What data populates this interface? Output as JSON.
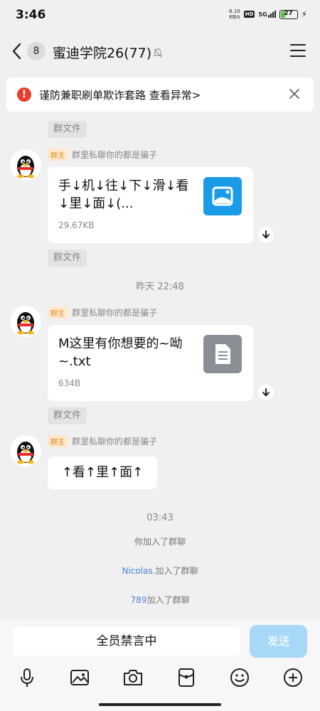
{
  "status_bar": {
    "time": "3:46",
    "net_speed_value": "6.10",
    "net_speed_unit": "KB/s",
    "hd": "HD",
    "network": "5G",
    "battery": "27",
    "battery_level": 0.27
  },
  "header": {
    "unread_count": "8",
    "title": "蜜迪学院26(77)"
  },
  "warning": {
    "text": "谨防兼职刷单欺诈套路 查看异常>"
  },
  "messages": [
    {
      "file_tag": "群文件"
    },
    {
      "owner_badge": "群主",
      "sender": "群里私聊你的都是骗子",
      "file_name": "手↓机↓往↓下↓滑↓看↓里↓面↓(...",
      "file_size": "29.67KB",
      "file_type": "image",
      "thumb_color": "#1a9be8",
      "file_tag": "群文件"
    },
    {
      "time": "昨天 22:48"
    },
    {
      "owner_badge": "群主",
      "sender": "群里私聊你的都是骗子",
      "file_name": "M这里有你想要的~呦~.txt",
      "file_size": "634B",
      "file_type": "document",
      "thumb_color": "#8a8f96",
      "file_tag": "群文件"
    },
    {
      "owner_badge": "群主",
      "sender": "群里私聊你的都是骗子",
      "text": "↑看↑里↑面↑"
    },
    {
      "time": "03:43"
    }
  ],
  "system_notes": {
    "joined_you": "你加入了群聊",
    "joined_1_name": "Nicolas.",
    "joined_1_suffix": "加入了群聊",
    "joined_2_name": "789",
    "joined_2_suffix": "加入了群聊"
  },
  "input": {
    "muted_text": "全员禁言中",
    "send_label": "发送"
  },
  "toolbar": [
    "mic-icon",
    "image-icon",
    "camera-icon",
    "red-packet-icon",
    "emoji-icon",
    "plus-icon"
  ],
  "colors": {
    "accent": "#1a9be8",
    "send_disabled": "#a7d8f7",
    "link": "#4a86d6",
    "warning_red": "#e8402f",
    "owner_badge": "#e58a1a"
  }
}
